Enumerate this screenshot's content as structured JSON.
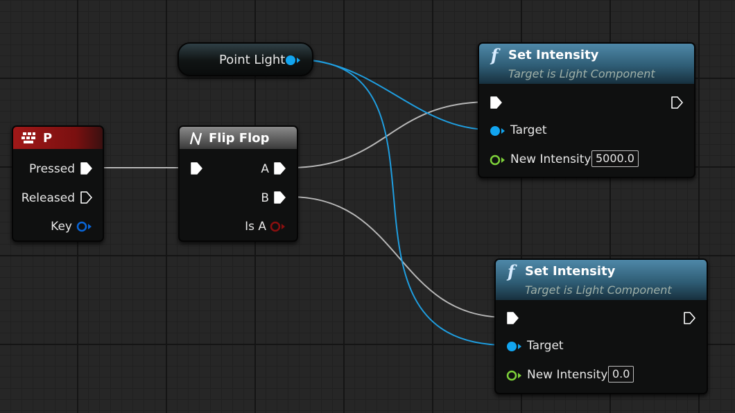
{
  "graph": {
    "colors": {
      "exec_wire": "#b8b8b8",
      "object_wire": "#1f9ee0",
      "object_pin": "#12a5f0",
      "float_pin": "#7ed23a",
      "bool_pin": "#8a0f0f",
      "key_pin": "#0a66d8",
      "event_header": "#a01818",
      "flipflop_header": "#6c6c6c",
      "function_header": "#3b6e8a"
    },
    "point_light": {
      "label": "Point Light"
    },
    "key_event": {
      "title": "P",
      "icon": "keyboard-icon",
      "pins": {
        "pressed": "Pressed",
        "released": "Released",
        "key": "Key"
      }
    },
    "flip_flop": {
      "title": "Flip Flop",
      "icon": "flipflop-icon",
      "pins": {
        "a": "A",
        "b": "B",
        "is_a": "Is A"
      }
    },
    "set_intensity_1": {
      "title": "Set Intensity",
      "subtitle": "Target is Light Component",
      "icon": "function-icon",
      "icon_glyph": "f",
      "pins": {
        "target": "Target",
        "new_intensity": "New Intensity"
      },
      "new_intensity_value": "5000.0"
    },
    "set_intensity_2": {
      "title": "Set Intensity",
      "subtitle": "Target is Light Component",
      "icon": "function-icon",
      "icon_glyph": "f",
      "pins": {
        "target": "Target",
        "new_intensity": "New Intensity"
      },
      "new_intensity_value": "0.0"
    }
  }
}
